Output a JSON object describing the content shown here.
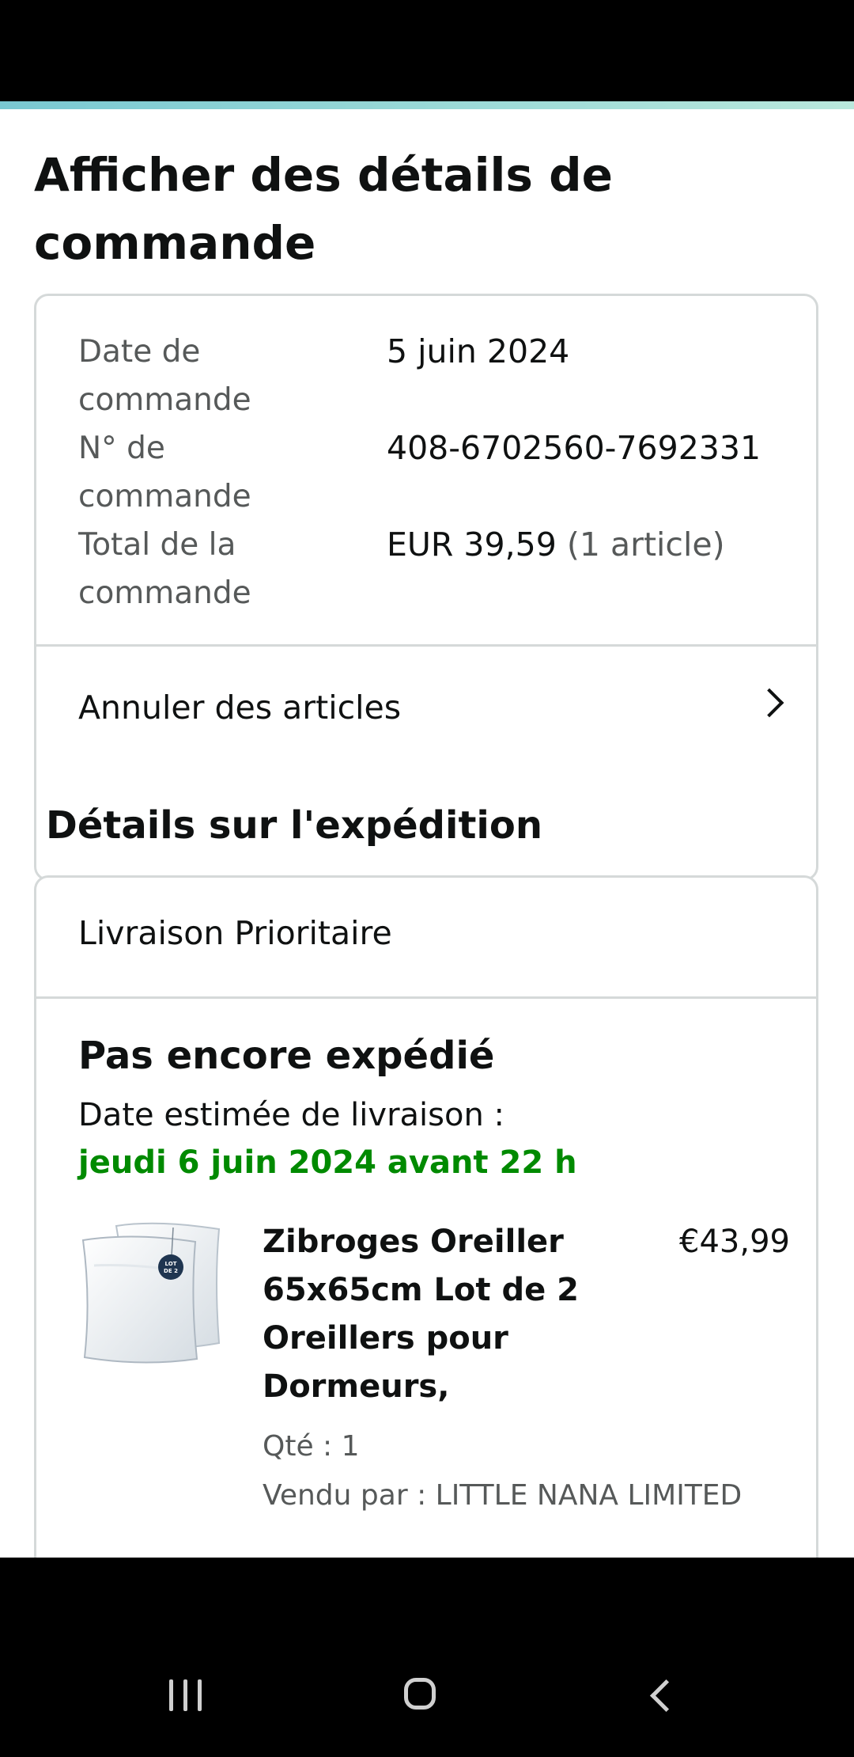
{
  "page": {
    "title": "Afficher des détails de commande"
  },
  "order_summary": {
    "rows": [
      {
        "label": "Date de commande",
        "value": "5 juin 2024"
      },
      {
        "label": "N° de commande",
        "value": "408-6702560-7692331"
      },
      {
        "label": "Total de la commande",
        "value": "EUR 39,59",
        "extra": "(1 article)"
      }
    ],
    "cancel_label": "Annuler des articles"
  },
  "shipment": {
    "section_title": "Détails sur l'expédition",
    "method": "Livraison Prioritaire",
    "status": "Pas encore expédié",
    "eta_label": "Date estimée de livraison :",
    "eta_value": "jeudi 6 juin 2024 avant 22 h",
    "product": {
      "title": "Zibroges Oreiller 65x65cm Lot de 2 Oreillers pour Dormeurs,",
      "price": "€43,99",
      "quantity": "Qté : 1",
      "seller": "Vendu par : LITTLE NANA LIMITED",
      "badge_text": "LOT DE 2"
    }
  },
  "colors": {
    "eta_green": "#008a00",
    "accent_line": "#79c8d2",
    "border": "#d5d9d9"
  },
  "icons": {
    "cancel": "chevron-right-icon",
    "nav": [
      "recents-icon",
      "home-icon",
      "back-icon"
    ]
  }
}
